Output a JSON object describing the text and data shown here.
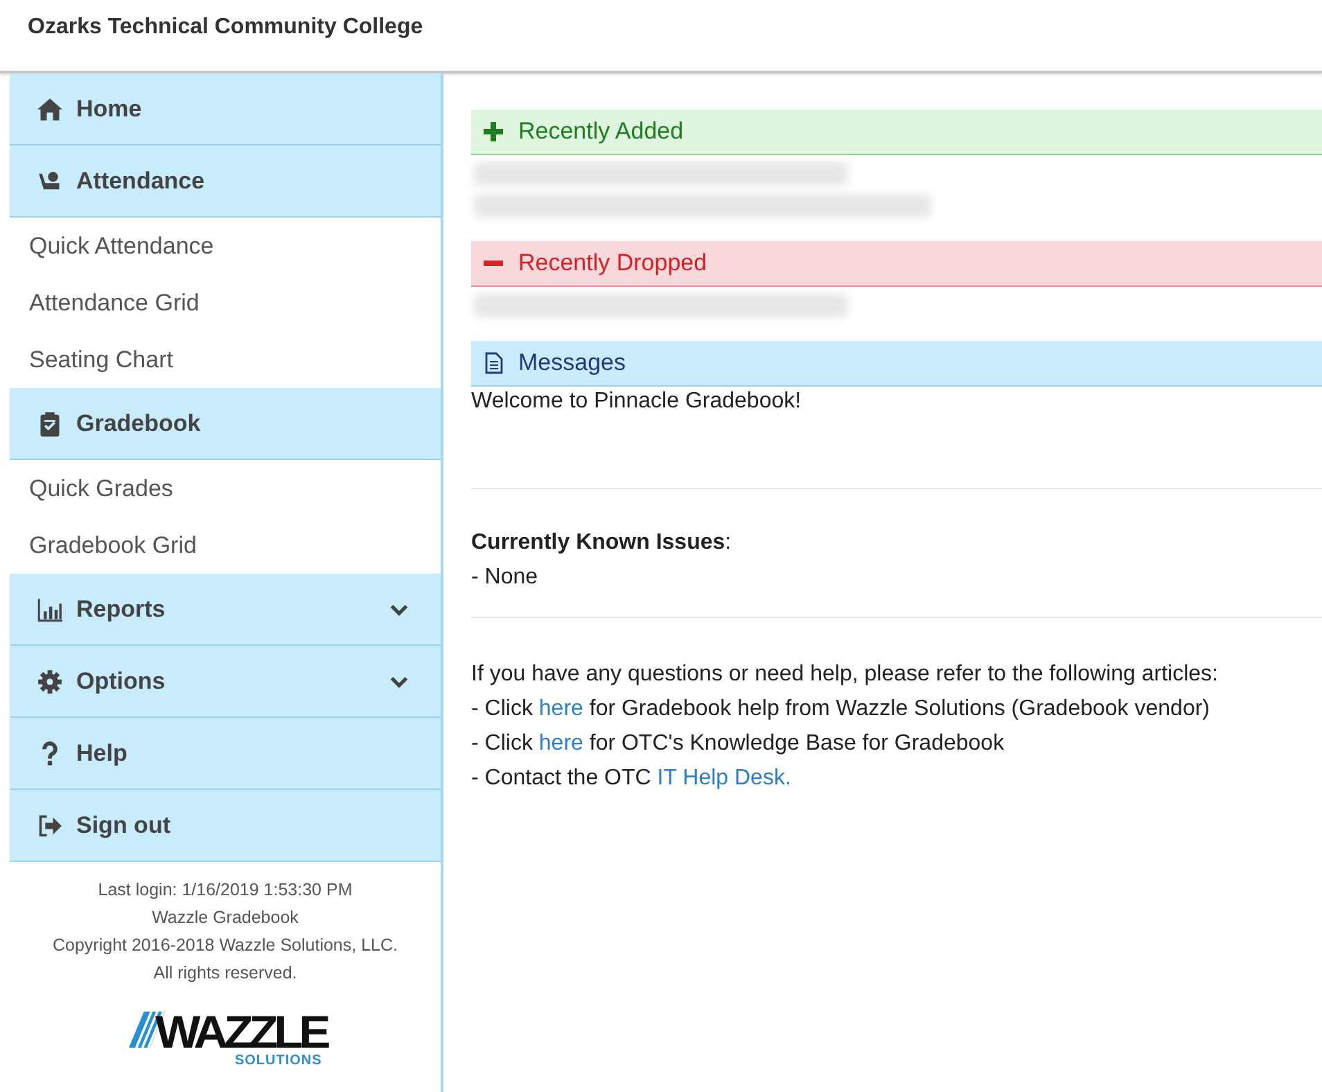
{
  "header": {
    "title": "Ozarks Technical Community College"
  },
  "sidebar": {
    "items": [
      {
        "label": "Home",
        "kind": "section",
        "expandable": false
      },
      {
        "label": "Attendance",
        "kind": "section",
        "expandable": false
      },
      {
        "label": "Quick Attendance",
        "kind": "link"
      },
      {
        "label": "Attendance Grid",
        "kind": "link"
      },
      {
        "label": "Seating Chart",
        "kind": "link"
      },
      {
        "label": "Gradebook",
        "kind": "section",
        "expandable": false
      },
      {
        "label": "Quick Grades",
        "kind": "link"
      },
      {
        "label": "Gradebook Grid",
        "kind": "link"
      },
      {
        "label": "Reports",
        "kind": "section",
        "expandable": true
      },
      {
        "label": "Options",
        "kind": "section",
        "expandable": true
      },
      {
        "label": "Help",
        "kind": "section",
        "expandable": false
      },
      {
        "label": "Sign out",
        "kind": "section",
        "expandable": false
      }
    ],
    "footer": [
      "Last login: 1/16/2019 1:53:30 PM",
      "Wazzle Gradebook",
      "Copyright 2016-2018 Wazzle Solutions, LLC.",
      "All rights reserved."
    ],
    "logo": {
      "name": "WAZZLE",
      "tagline": "SOLUTIONS"
    }
  },
  "panels": [
    {
      "kind": "added",
      "title": "Recently Added",
      "entries": [
        {
          "kind": "redacted"
        },
        {
          "kind": "redacted"
        }
      ]
    },
    {
      "kind": "dropped",
      "title": "Recently Dropped",
      "entries": [
        {
          "kind": "redacted"
        }
      ]
    },
    {
      "kind": "messages",
      "title": "Messages"
    }
  ],
  "messages": {
    "welcome": "Welcome to Pinnacle Gradebook!",
    "issues_title": "**Currently Known Issues**:",
    "issues": [
      "- None"
    ],
    "help_lines": [
      {
        "before": "If you have any questions or need help, please refer to the following articles:"
      },
      {
        "before": "- Click ",
        "link": "here",
        "after": " for Gradebook help from Wazzle Solutions (Gradebook vendor)"
      },
      {
        "before": "- Click ",
        "link": "here",
        "after": " for OTC's Knowledge Base for Gradebook"
      },
      {
        "before": "- Contact the OTC ",
        "link": "IT Help Desk."
      }
    ]
  }
}
